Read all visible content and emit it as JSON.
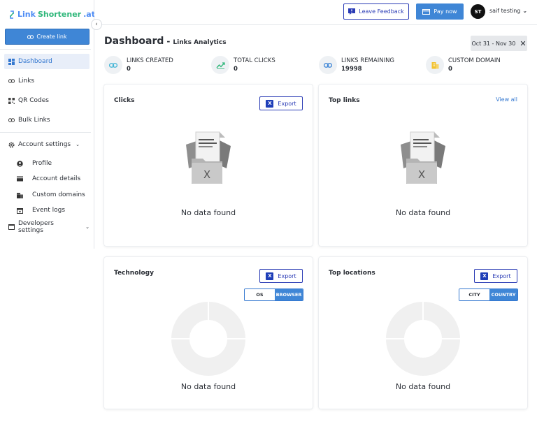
{
  "brand": {
    "part1": "Link",
    "part2": "Shortener",
    "part3": ".at"
  },
  "sidebar": {
    "create_label": "Create link",
    "items": [
      {
        "label": "Dashboard",
        "active": true
      },
      {
        "label": "Links"
      },
      {
        "label": "QR Codes"
      },
      {
        "label": "Bulk Links"
      }
    ],
    "account_settings": {
      "label": "Account settings",
      "sub": [
        {
          "label": "Profile"
        },
        {
          "label": "Account details"
        },
        {
          "label": "Custom domains"
        },
        {
          "label": "Event logs"
        }
      ]
    },
    "developers_settings": {
      "label": "Developers settings"
    }
  },
  "header": {
    "feedback_label": "Leave Feedback",
    "paynow_label": "Pay now",
    "avatar_initials": "ST",
    "username": "saif testing"
  },
  "main": {
    "title": "Dashboard",
    "title_separator": "-",
    "subtitle": "Links Analytics",
    "date_range": "Oct 31 - Nov 30",
    "stats": [
      {
        "label": "LINKS CREATED",
        "value": "0"
      },
      {
        "label": "TOTAL CLICKS",
        "value": "0"
      },
      {
        "label": "LINKS REMAINING",
        "value": "19998"
      },
      {
        "label": "CUSTOM DOMAIN",
        "value": "0"
      }
    ],
    "cards": {
      "clicks": {
        "title": "Clicks",
        "export": "Export",
        "empty": "No data found"
      },
      "top_links": {
        "title": "Top links",
        "view_all": "View all",
        "empty": "No data found"
      },
      "technology": {
        "title": "Technology",
        "export": "Export",
        "toggle": [
          "OS",
          "BROWSER"
        ],
        "selected": "BROWSER",
        "empty": "No data found"
      },
      "top_locations": {
        "title": "Top locations",
        "export": "Export",
        "toggle": [
          "CITY",
          "COUNTRY"
        ],
        "selected": "COUNTRY",
        "empty": "No data found"
      }
    }
  },
  "colors": {
    "primary": "#3f86d6",
    "accent_navy": "#2a3bb5",
    "active_bg": "#e8eef9",
    "brand_green": "#2fb77a"
  }
}
